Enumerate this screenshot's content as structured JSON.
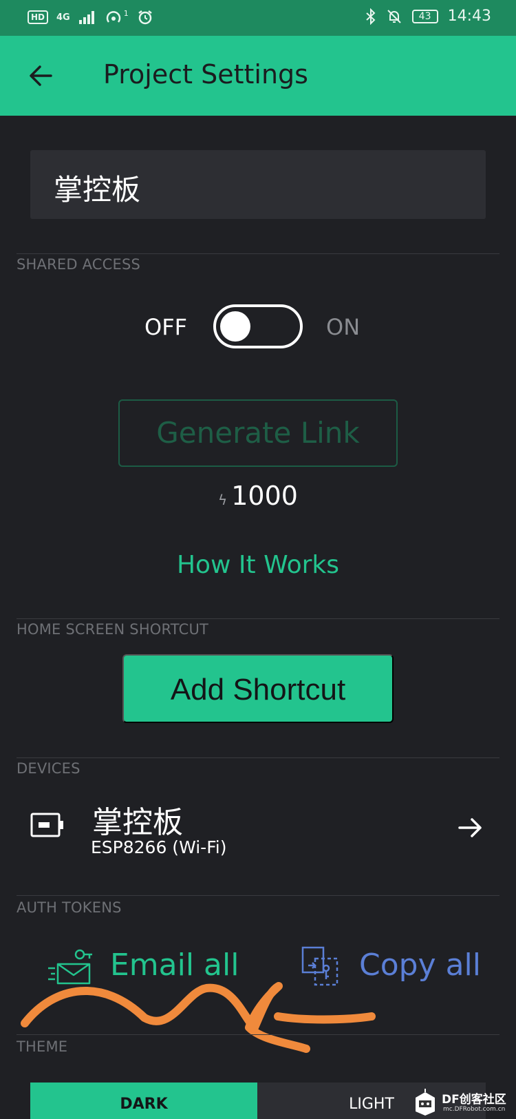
{
  "status_bar": {
    "hd": "HD",
    "network": "4G",
    "hotspot_count": "1",
    "battery": "43",
    "time": "14:43"
  },
  "app_bar": {
    "title": "Project Settings"
  },
  "project": {
    "name": "掌控板"
  },
  "shared_access": {
    "section_label": "SHARED ACCESS",
    "off_label": "OFF",
    "on_label": "ON",
    "enabled": false,
    "generate_link_label": "Generate Link",
    "cost": "1000",
    "how_it_works_label": "How It Works"
  },
  "home_screen_shortcut": {
    "section_label": "HOME SCREEN SHORTCUT",
    "button_label": "Add Shortcut"
  },
  "devices": {
    "section_label": "DEVICES",
    "items": [
      {
        "name": "掌控板",
        "type": "ESP8266 (Wi-Fi)",
        "icon": "device-board-icon"
      }
    ]
  },
  "auth_tokens": {
    "section_label": "AUTH TOKENS",
    "email_all_label": "Email all",
    "copy_all_label": "Copy all"
  },
  "theme": {
    "section_label": "THEME",
    "options": [
      "DARK",
      "LIGHT"
    ],
    "selected": "DARK"
  },
  "watermark": {
    "brand": "DF创客社区",
    "url": "mc.DFRobot.com.cn"
  },
  "colors": {
    "accent": "#23c48e",
    "status_bar": "#1e8a5f",
    "background": "#1f2024",
    "field": "#2d2e33",
    "copy_blue": "#5b7fd6",
    "annotation": "#f08a3c"
  }
}
